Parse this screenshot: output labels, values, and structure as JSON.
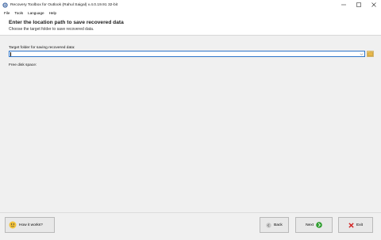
{
  "window": {
    "title": "Recovery Toolbox for Outlook (Rahul Saigal) v.4.0.19.91 32-bit"
  },
  "menu": {
    "items": [
      "File",
      "Tools",
      "Language",
      "Help"
    ]
  },
  "header": {
    "title": "Enter the location path to save recovered data",
    "subtitle": "Choose the target folder to save recovered data."
  },
  "target": {
    "label": "Target folder for saving recovered data:",
    "value": ""
  },
  "disk": {
    "label": "Free disk space:"
  },
  "buttons": {
    "how_it_works": "How it works?",
    "back": "Back",
    "next": "Next",
    "exit": "Exit"
  },
  "colors": {
    "accent": "#2e75c9",
    "next_green": "#2f9e2f",
    "exit_red": "#d21f1f",
    "folder_yellow": "#e8b84a"
  },
  "icons": {
    "app": "recovery-toolbox-app-icon",
    "folder": "folder-icon",
    "how": "helper-icon",
    "back": "back-arrow-icon",
    "next": "next-arrow-icon",
    "exit": "exit-x-icon"
  }
}
